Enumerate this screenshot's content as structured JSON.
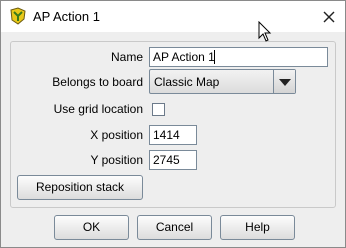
{
  "window": {
    "title": "AP Action 1",
    "icon": "app-logo-icon",
    "close_icon": "close-icon"
  },
  "form": {
    "name_label": "Name",
    "name_value": "AP Action 1",
    "board_label": "Belongs to board",
    "board_value": "Classic Map",
    "grid_label": "Use grid location",
    "grid_checked": false,
    "x_label": "X position",
    "x_value": "1414",
    "y_label": "Y position",
    "y_value": "2745",
    "reposition_label": "Reposition stack"
  },
  "buttons": {
    "ok": "OK",
    "cancel": "Cancel",
    "help": "Help"
  },
  "colors": {
    "window_bg": "#eeeeee",
    "logo_yellow": "#e8c81a",
    "logo_green": "#3a7a1a"
  }
}
